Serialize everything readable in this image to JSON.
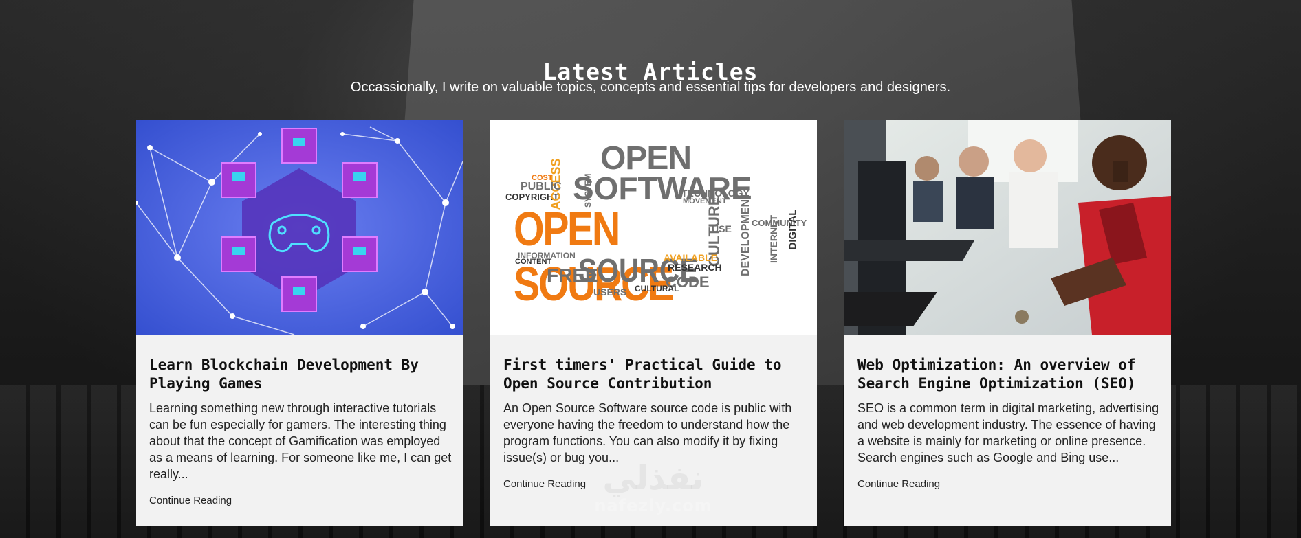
{
  "section": {
    "title": "Latest Articles",
    "subtitle": "Occassionally, I write on valuable topics, concepts and essential tips for developers and designers."
  },
  "articles": [
    {
      "title": "Learn Blockchain Development By Playing Games",
      "excerpt": "Learning something new through interactive tutorials can be fun especially for gamers. The interesting thing about that the concept of Gamification was employed as a means of learning. For someone like me, I can get really...",
      "link": "Continue Reading",
      "image": "blockchain-game-cubes"
    },
    {
      "title": "First timers' Practical Guide to Open Source Contribution",
      "excerpt": "An Open Source Software source code is public with everyone having the freedom to understand how the program functions. You can also modify it by fixing issue(s) or bug you...",
      "link": "Continue Reading",
      "image": "open-source-word-cloud",
      "cloud_words": [
        "OPEN",
        "SOFTWARE",
        "OPEN SOURCE",
        "SOURCE",
        "FREE",
        "CODE",
        "CULTURE",
        "COPYRIGHT",
        "ACCESS",
        "PUBLIC",
        "DEVELOPMENT",
        "COMMUNITY",
        "DIGITAL",
        "INFORMATION",
        "RESEARCH",
        "USERS",
        "SYSTEM",
        "TECHNOLOGY",
        "AVAILABLE",
        "USE",
        "INTERNET",
        "CONTENT",
        "CULTURAL",
        "MOVEMENT",
        "COST"
      ]
    },
    {
      "title": "Web Optimization: An overview of Search Engine Optimization (SEO)",
      "excerpt": "SEO is a common term in digital marketing, advertising and web development industry. The essence of having a website is mainly for marketing or online presence. Search engines such as Google and Bing use...",
      "link": "Continue Reading",
      "image": "people-at-computers"
    }
  ],
  "watermark": {
    "arabic": "نفذلي",
    "latin": "nafezly.com"
  },
  "colors": {
    "card_bg": "#f2f2f2",
    "cloud_orange": "#f07a12",
    "cloud_gray": "#6f6f6f",
    "blockchain_blue": "#3f5fd8",
    "cube_purple": "#9b2fc9"
  }
}
